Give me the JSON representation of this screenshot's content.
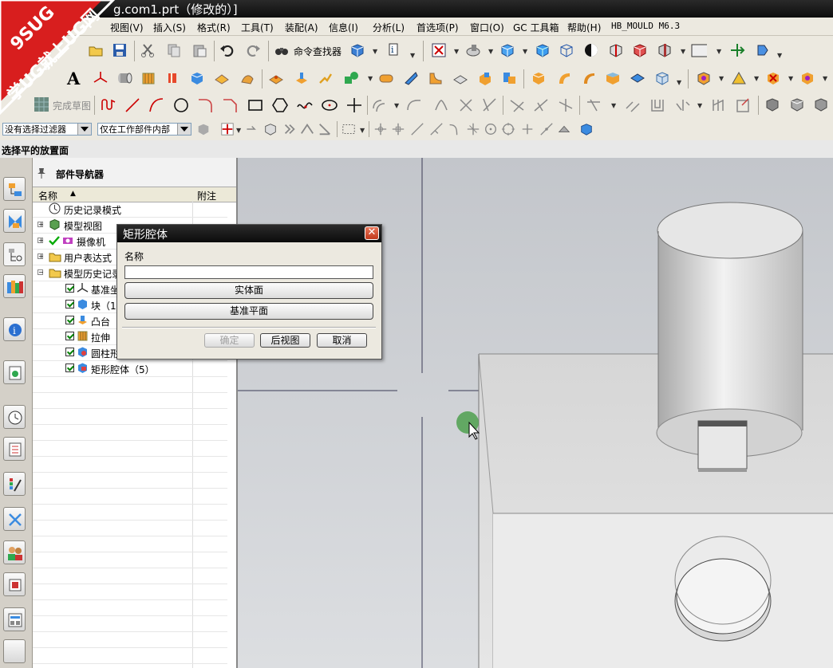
{
  "window": {
    "title": "g.com1.prt（修改的）]"
  },
  "menu": [
    "视图(V)",
    "插入(S)",
    "格式(R)",
    "工具(T)",
    "装配(A)",
    "信息(I)",
    "分析(L)",
    "首选项(P)",
    "窗口(O)",
    "GC 工具箱",
    "帮助(H)",
    "HB_MOULD M6.3"
  ],
  "toolbar": {
    "command_finder": "命令查找器",
    "finish_sketch": "完成草图",
    "layer_value": "1"
  },
  "selection_bar": {
    "filter": "没有选择过滤器",
    "scope": "仅在工作部件内部"
  },
  "cue_line": "选择平的放置面",
  "navigator": {
    "title": "部件导航器",
    "col_name": "名称",
    "col_note": "附注",
    "rows": [
      {
        "label": "历史记录模式"
      },
      {
        "label": "模型视图"
      },
      {
        "label": "摄像机"
      },
      {
        "label": "用户表达式"
      },
      {
        "label": "模型历史记录"
      },
      {
        "label": "基准坐"
      },
      {
        "label": "块（1"
      },
      {
        "label": "凸台"
      },
      {
        "label": "拉伸"
      },
      {
        "label": "圆柱形"
      },
      {
        "label": "矩形腔体（5）"
      }
    ]
  },
  "dialog": {
    "title": "矩形腔体",
    "name_label": "名称",
    "name_value": "",
    "btn_solid_face": "实体面",
    "btn_datum_plane": "基准平面",
    "btn_ok": "确定",
    "btn_back": "后视图",
    "btn_cancel": "取消"
  },
  "watermark": {
    "line1": "9SUG",
    "line2": "学UG就上UG网"
  },
  "colors": {
    "title_bg": "#111111",
    "toolbar_bg": "#ece9e0",
    "graphics_bg": "#cfd2d6",
    "part_gray": "#d9d9d9",
    "close_red": "#d4502f"
  }
}
